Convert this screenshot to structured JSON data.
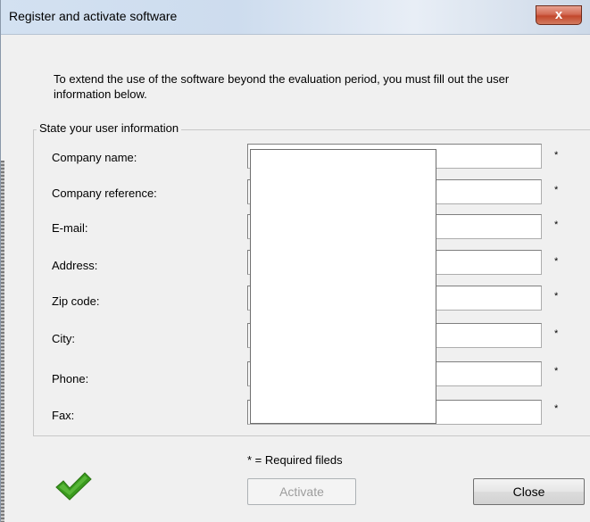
{
  "window": {
    "title": "Register and activate software",
    "close_glyph": "x"
  },
  "intro": "To extend the use of the software beyond the evaluation period, you must fill out the user information below.",
  "group": {
    "legend": "State your user information",
    "fields": [
      {
        "label": "Company name:",
        "value": "",
        "required_mark": "*"
      },
      {
        "label": "Company reference:",
        "value": "",
        "required_mark": "*"
      },
      {
        "label": "E-mail:",
        "value": "",
        "required_mark": "*"
      },
      {
        "label": "Address:",
        "value": "",
        "required_mark": "*"
      },
      {
        "label": "Zip code:",
        "value": "",
        "required_mark": "*"
      },
      {
        "label": "City:",
        "value": "",
        "required_mark": "*"
      },
      {
        "label": "Phone:",
        "value": "",
        "required_mark": "*"
      },
      {
        "label": "Fax:",
        "value": "",
        "required_mark": "*"
      }
    ]
  },
  "footer": {
    "required_note": "* = Required fileds",
    "activate_label": "Activate",
    "close_label": "Close",
    "status_icon": "green-check-icon",
    "accent_green": "#3a9a1e"
  }
}
